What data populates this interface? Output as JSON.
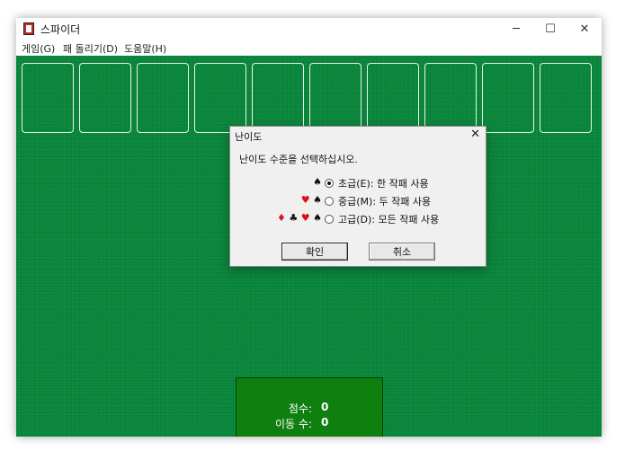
{
  "window": {
    "title": "스파이더",
    "minimize_glyph": "─",
    "maximize_glyph": "☐",
    "close_glyph": "✕"
  },
  "menu": [
    "게임(G)",
    "패 돌리기(D)",
    "도움말(H)"
  ],
  "table": {
    "slot_count": 10,
    "felt_color": "#0b8a3e"
  },
  "score": {
    "score_label": "점수:",
    "score_value": "0",
    "moves_label": "이동 수:",
    "moves_value": "0"
  },
  "dialog": {
    "title": "난이도",
    "close_glyph": "✕",
    "prompt": "난이도 수준을 선택하십시오.",
    "options": [
      {
        "label": "초급(E): 한 작패 사용",
        "selected": true,
        "suits": [
          {
            "glyph": "♠",
            "color": "black"
          }
        ]
      },
      {
        "label": "중급(M): 두 작패 사용",
        "selected": false,
        "suits": [
          {
            "glyph": "♥",
            "color": "red"
          },
          {
            "glyph": "♠",
            "color": "black"
          }
        ]
      },
      {
        "label": "고급(D): 모든 작패 사용",
        "selected": false,
        "suits": [
          {
            "glyph": "♦",
            "color": "red"
          },
          {
            "glyph": "♣",
            "color": "black"
          },
          {
            "glyph": "♥",
            "color": "red"
          },
          {
            "glyph": "♠",
            "color": "black"
          }
        ]
      }
    ],
    "ok_label": "확인",
    "cancel_label": "취소"
  }
}
